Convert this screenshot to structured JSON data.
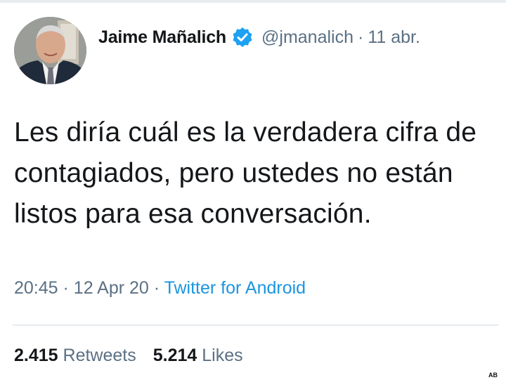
{
  "tweet": {
    "author_name": "Jaime Mañalich",
    "handle": "@jmanalich",
    "separator": "·",
    "relative_date": "11 abr.",
    "text": "Les diría cuál es la verdadera cifra de contagiados, pero ustedes no están listos para esa conversación.",
    "time": "20:45",
    "date": "12 Apr 20",
    "source": "Twitter for Android",
    "retweets_count": "2.415",
    "retweets_label": "Retweets",
    "likes_count": "5.214",
    "likes_label": "Likes"
  },
  "watermark": "AB",
  "icons": {
    "verified": "verified-badge-icon"
  },
  "colors": {
    "link": "#1b95e0",
    "secondary": "#5b7083",
    "verified": "#1da1f2"
  }
}
